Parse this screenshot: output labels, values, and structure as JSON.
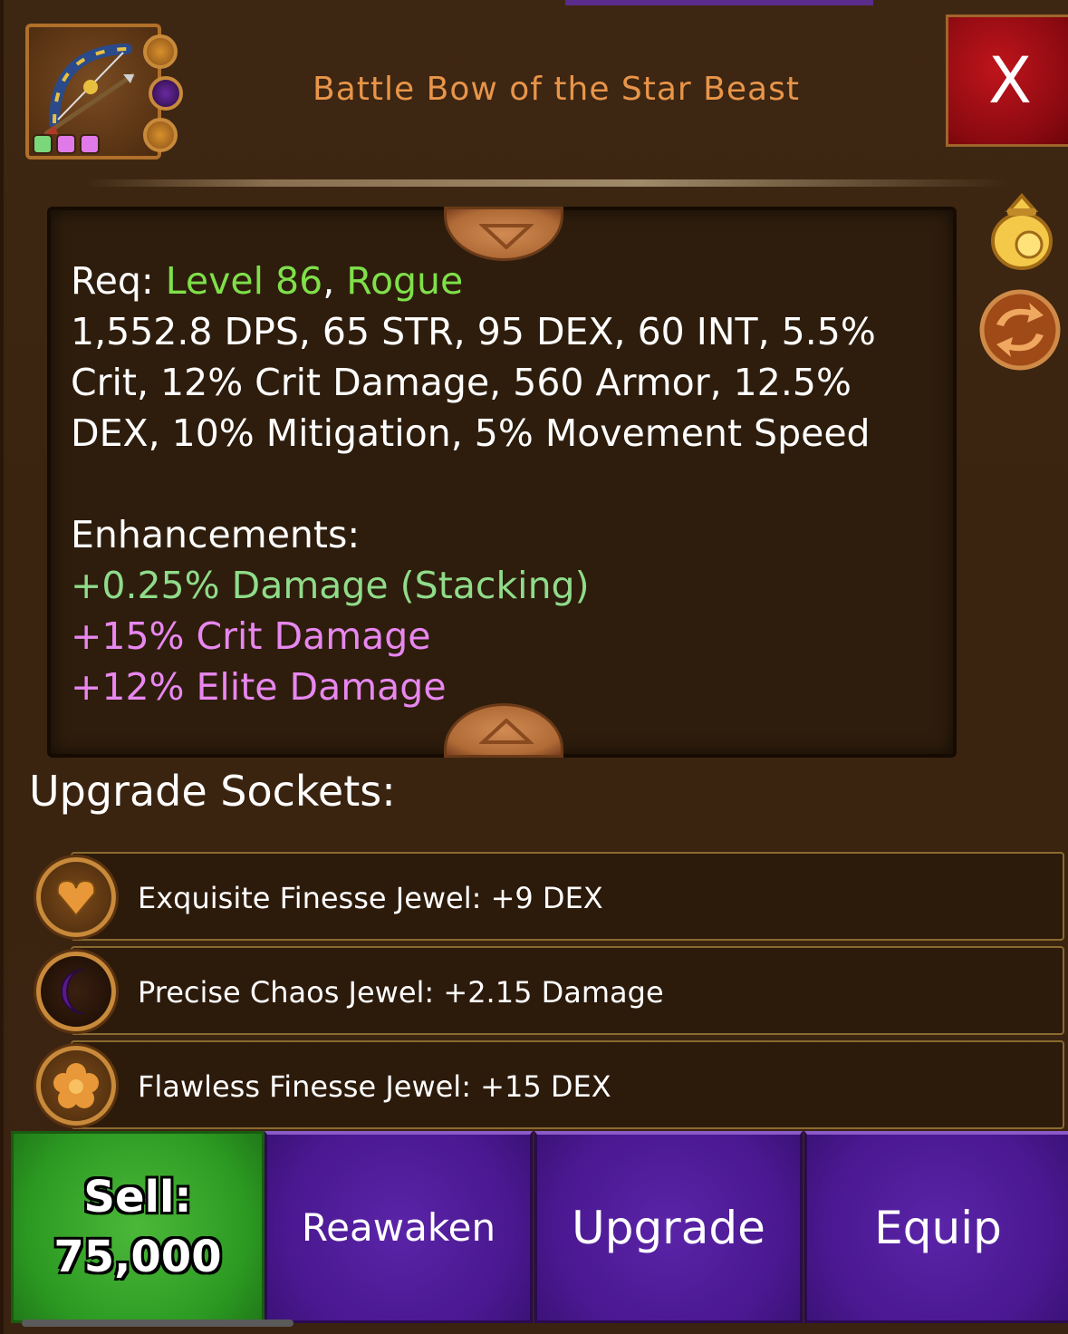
{
  "item": {
    "title": "Battle Bow of the Star Beast",
    "icon": "bow-icon",
    "rarity_dots": [
      "#7ad87a",
      "#e07ae8",
      "#e07ae8"
    ],
    "gem_slots": [
      "heart-gem-icon",
      "crescent-gem-icon",
      "flower-gem-icon"
    ]
  },
  "close": {
    "label": "X"
  },
  "side_buttons": {
    "bag": "coin-bag-icon",
    "swap": "swap-icon"
  },
  "stats": {
    "req_label": "Req:",
    "req_level": "Level 86",
    "req_sep": ",",
    "req_class": "Rogue",
    "lines": [
      "1,552.8 DPS, 65 STR, 95 DEX, 60 INT, 5.5%",
      "Crit, 12% Crit Damage, 560 Armor, 12.5%",
      "DEX, 10% Mitigation, 5% Movement Speed"
    ],
    "enhancements_heading": "Enhancements:",
    "enhancements": [
      {
        "text": "+0.25% Damage (Stacking)",
        "color": "#8fdc8a"
      },
      {
        "text": "+15% Crit Damage",
        "color": "#e887f0"
      },
      {
        "text": "+12% Elite Damage",
        "color": "#e887f0"
      }
    ]
  },
  "sockets": {
    "heading": "Upgrade Sockets:",
    "items": [
      {
        "label": "Exquisite Finesse Jewel: +9 DEX",
        "icon": "heart-jewel-icon"
      },
      {
        "label": "Precise Chaos Jewel: +2.15 Damage",
        "icon": "crescent-jewel-icon"
      },
      {
        "label": "Flawless Finesse Jewel: +15 DEX",
        "icon": "flower-jewel-icon"
      }
    ]
  },
  "actions": {
    "sell_label": "Sell:",
    "sell_price": "75,000",
    "reawaken": "Reawaken",
    "upgrade": "Upgrade",
    "equip": "Equip"
  }
}
